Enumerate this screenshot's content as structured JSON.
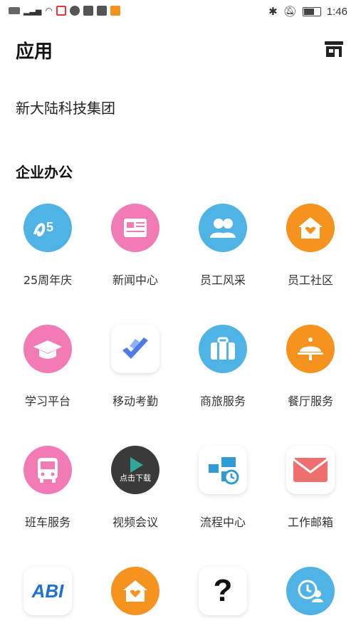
{
  "status_bar": {
    "time": "1:46",
    "icons": [
      "hd-icon",
      "signal-icon",
      "wifi-icon",
      "app-notification-icon",
      "vpn-icon",
      "message-icon",
      "download-icon",
      "video-icon",
      "bluetooth-icon",
      "mute-icon",
      "battery-icon"
    ]
  },
  "header": {
    "title": "应用",
    "store_icon": "store-icon"
  },
  "organization": "新大陆科技集团",
  "section": {
    "title": "企业办公"
  },
  "apps": [
    {
      "label": "25周年庆",
      "icon": "anniversary-icon",
      "color": "#4FB3E6"
    },
    {
      "label": "新闻中心",
      "icon": "news-icon",
      "color": "#F27BB6"
    },
    {
      "label": "员工风采",
      "icon": "people-icon",
      "color": "#4FB3E6"
    },
    {
      "label": "员工社区",
      "icon": "home-heart-icon",
      "color": "#F6921E"
    },
    {
      "label": "学习平台",
      "icon": "graduation-cap-icon",
      "color": "#F27BB6"
    },
    {
      "label": "移动考勤",
      "icon": "attendance-check-icon",
      "color": "#4F7BE6"
    },
    {
      "label": "商旅服务",
      "icon": "suitcase-icon",
      "color": "#4FB3E6"
    },
    {
      "label": "餐厅服务",
      "icon": "food-cloche-icon",
      "color": "#F6921E"
    },
    {
      "label": "班车服务",
      "icon": "bus-icon",
      "color": "#F27BB6"
    },
    {
      "label": "视频会议",
      "icon": "video-play-icon",
      "color": "#333333",
      "overlay_text": "点击下载"
    },
    {
      "label": "流程中心",
      "icon": "workflow-icon",
      "color": "#2E9BD6"
    },
    {
      "label": "工作邮箱",
      "icon": "mail-icon",
      "color": "#EF6F6F"
    },
    {
      "label": "",
      "icon": "abi-icon",
      "color": "#1E6FD6",
      "text": "ABI"
    },
    {
      "label": "",
      "icon": "home-heart-icon",
      "color": "#F6921E"
    },
    {
      "label": "",
      "icon": "question-icon",
      "color": "#111111",
      "text": "?"
    },
    {
      "label": "",
      "icon": "clock-person-icon",
      "color": "#4FB3E6"
    }
  ]
}
